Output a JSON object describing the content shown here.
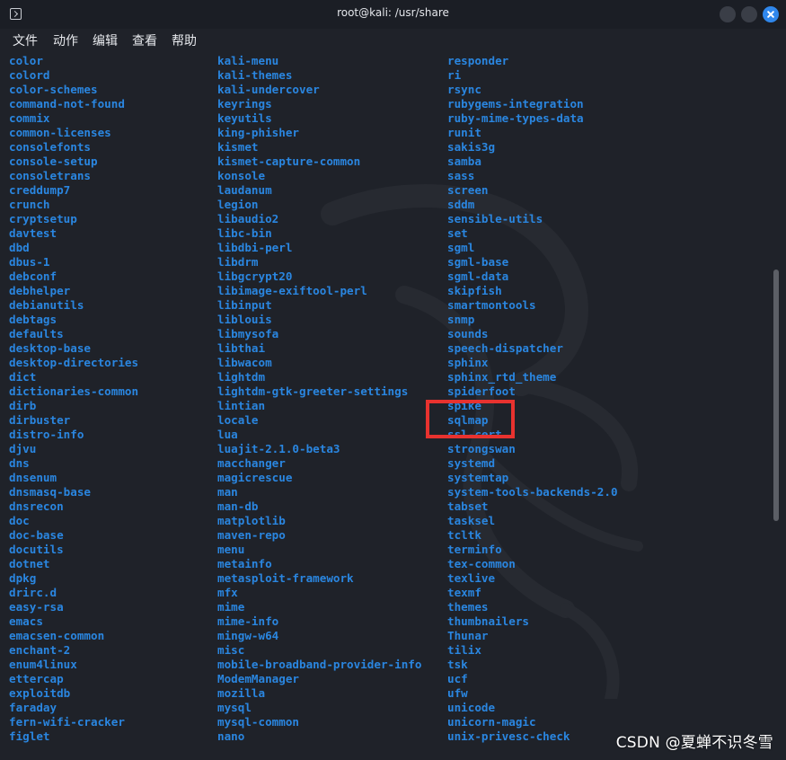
{
  "window": {
    "title": "root@kali: /usr/share",
    "close_color": "#2f87ec"
  },
  "menu": {
    "items": [
      "文件",
      "动作",
      "编辑",
      "查看",
      "帮助"
    ]
  },
  "terminal": {
    "text_color": "#2a86e0",
    "columns": [
      [
        "color",
        "colord",
        "color-schemes",
        "command-not-found",
        "commix",
        "common-licenses",
        "consolefonts",
        "console-setup",
        "consoletrans",
        "creddump7",
        "crunch",
        "cryptsetup",
        "davtest",
        "dbd",
        "dbus-1",
        "debconf",
        "debhelper",
        "debianutils",
        "debtags",
        "defaults",
        "desktop-base",
        "desktop-directories",
        "dict",
        "dictionaries-common",
        "dirb",
        "dirbuster",
        "distro-info",
        "djvu",
        "dns",
        "dnsenum",
        "dnsmasq-base",
        "dnsrecon",
        "doc",
        "doc-base",
        "docutils",
        "dotnet",
        "dpkg",
        "drirc.d",
        "easy-rsa",
        "emacs",
        "emacsen-common",
        "enchant-2",
        "enum4linux",
        "ettercap",
        "exploitdb",
        "faraday",
        "fern-wifi-cracker",
        "figlet"
      ],
      [
        "kali-menu",
        "kali-themes",
        "kali-undercover",
        "keyrings",
        "keyutils",
        "king-phisher",
        "kismet",
        "kismet-capture-common",
        "konsole",
        "laudanum",
        "legion",
        "libaudio2",
        "libc-bin",
        "libdbi-perl",
        "libdrm",
        "libgcrypt20",
        "libimage-exiftool-perl",
        "libinput",
        "liblouis",
        "libmysofa",
        "libthai",
        "libwacom",
        "lightdm",
        "lightdm-gtk-greeter-settings",
        "lintian",
        "locale",
        "lua",
        "luajit-2.1.0-beta3",
        "macchanger",
        "magicrescue",
        "man",
        "man-db",
        "matplotlib",
        "maven-repo",
        "menu",
        "metainfo",
        "metasploit-framework",
        "mfx",
        "mime",
        "mime-info",
        "mingw-w64",
        "misc",
        "mobile-broadband-provider-info",
        "ModemManager",
        "mozilla",
        "mysql",
        "mysql-common",
        "nano"
      ],
      [
        "responder",
        "ri",
        "rsync",
        "rubygems-integration",
        "ruby-mime-types-data",
        "runit",
        "sakis3g",
        "samba",
        "sass",
        "screen",
        "sddm",
        "sensible-utils",
        "set",
        "sgml",
        "sgml-base",
        "sgml-data",
        "skipfish",
        "smartmontools",
        "snmp",
        "sounds",
        "speech-dispatcher",
        "sphinx",
        "sphinx_rtd_theme",
        "spiderfoot",
        "spike",
        "sqlmap",
        "ssl-cert",
        "strongswan",
        "systemd",
        "systemtap",
        "system-tools-backends-2.0",
        "tabset",
        "tasksel",
        "tcltk",
        "terminfo",
        "tex-common",
        "texlive",
        "texmf",
        "themes",
        "thumbnailers",
        "Thunar",
        "tilix",
        "tsk",
        "ucf",
        "ufw",
        "unicode",
        "unicorn-magic",
        "unix-privesc-check"
      ]
    ],
    "highlighted_entry": "sqlmap",
    "highlight_color": "#e8322f"
  },
  "watermark": {
    "text": "CSDN @夏蝉不识冬雪"
  }
}
